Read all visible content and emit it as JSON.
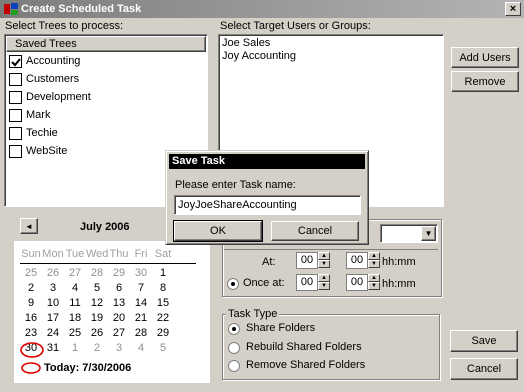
{
  "window": {
    "title": "Create Scheduled Task",
    "close_glyph": "×"
  },
  "left_panel": {
    "label": "Select Trees to process:",
    "tree_header": "Saved Trees",
    "trees": [
      {
        "label": "Accounting",
        "checked": true
      },
      {
        "label": "Customers",
        "checked": false
      },
      {
        "label": "Development",
        "checked": false
      },
      {
        "label": "Mark",
        "checked": false
      },
      {
        "label": "Techie",
        "checked": false
      },
      {
        "label": "WebSite",
        "checked": false
      }
    ]
  },
  "target_panel": {
    "label": "Select Target Users or Groups:",
    "items": [
      "Joe Sales",
      "Joy Accounting"
    ],
    "add_button": "Add Users",
    "remove_button": "Remove"
  },
  "calendar": {
    "month_title": "July 2006",
    "prev_glyph": "◄",
    "next_glyph": "►",
    "weekday_headers": [
      "Sun",
      "Mon",
      "Tue",
      "Wed",
      "Thu",
      "Fri",
      "Sat"
    ],
    "weeks": [
      [
        "25",
        "26",
        "27",
        "28",
        "29",
        "30",
        "1"
      ],
      [
        "2",
        "3",
        "4",
        "5",
        "6",
        "7",
        "8"
      ],
      [
        "9",
        "10",
        "11",
        "12",
        "13",
        "14",
        "15"
      ],
      [
        "16",
        "17",
        "18",
        "19",
        "20",
        "21",
        "22"
      ],
      [
        "23",
        "24",
        "25",
        "26",
        "27",
        "28",
        "29"
      ],
      [
        "30",
        "31",
        "1",
        "2",
        "3",
        "4",
        "5"
      ]
    ],
    "today_label": "Today: 7/30/2006",
    "accent_circle_color": "#e00000"
  },
  "schedule": {
    "at_label": "At:",
    "at_hour": "00",
    "at_min": "00",
    "hhmm_1": "hh:mm",
    "once_label": "Once at:",
    "once_hour": "00",
    "once_min": "00",
    "hhmm_2": "hh:mm"
  },
  "task_type": {
    "legend": "Task Type",
    "options": [
      {
        "label": "Share Folders",
        "selected": true
      },
      {
        "label": "Rebuild Shared Folders",
        "selected": false
      },
      {
        "label": "Remove Shared Folders",
        "selected": false
      }
    ]
  },
  "buttons": {
    "save": "Save",
    "cancel": "Cancel"
  },
  "save_dialog": {
    "title": "Save Task",
    "prompt": "Please enter Task name:",
    "value": "JoyJoeShareAccounting",
    "ok": "OK",
    "cancel": "Cancel"
  }
}
